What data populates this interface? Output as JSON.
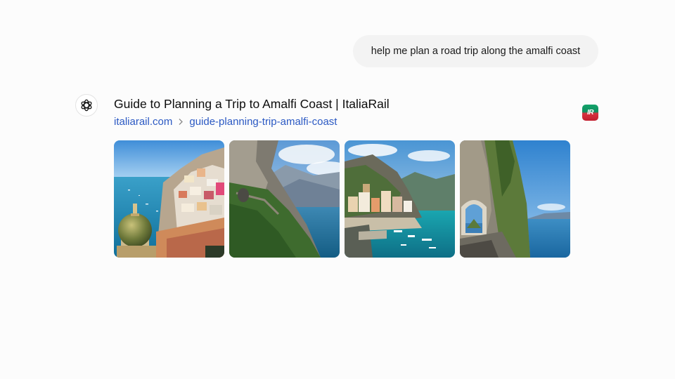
{
  "user_message": {
    "text": "help me plan a road trip along the amalfi coast"
  },
  "assistant": {
    "avatar_icon": "openai-logo-icon",
    "result": {
      "title": "Guide to Planning a Trip to Amalfi Coast | ItaliaRail",
      "url_domain": "italiarail.com",
      "url_path": "guide-planning-trip-amalfi-coast",
      "url_separator_icon": "chevron-right-icon",
      "site_logo_text": "IR",
      "site_logo_colors": [
        "#13a36a",
        "#c2202f"
      ],
      "link_color": "#2b59c3"
    },
    "images": [
      {
        "name": "positano-church-dome-photo"
      },
      {
        "name": "coastal-cliff-road-photo"
      },
      {
        "name": "amalfi-town-harbor-photo"
      },
      {
        "name": "cliff-road-tunnel-photo"
      }
    ]
  }
}
